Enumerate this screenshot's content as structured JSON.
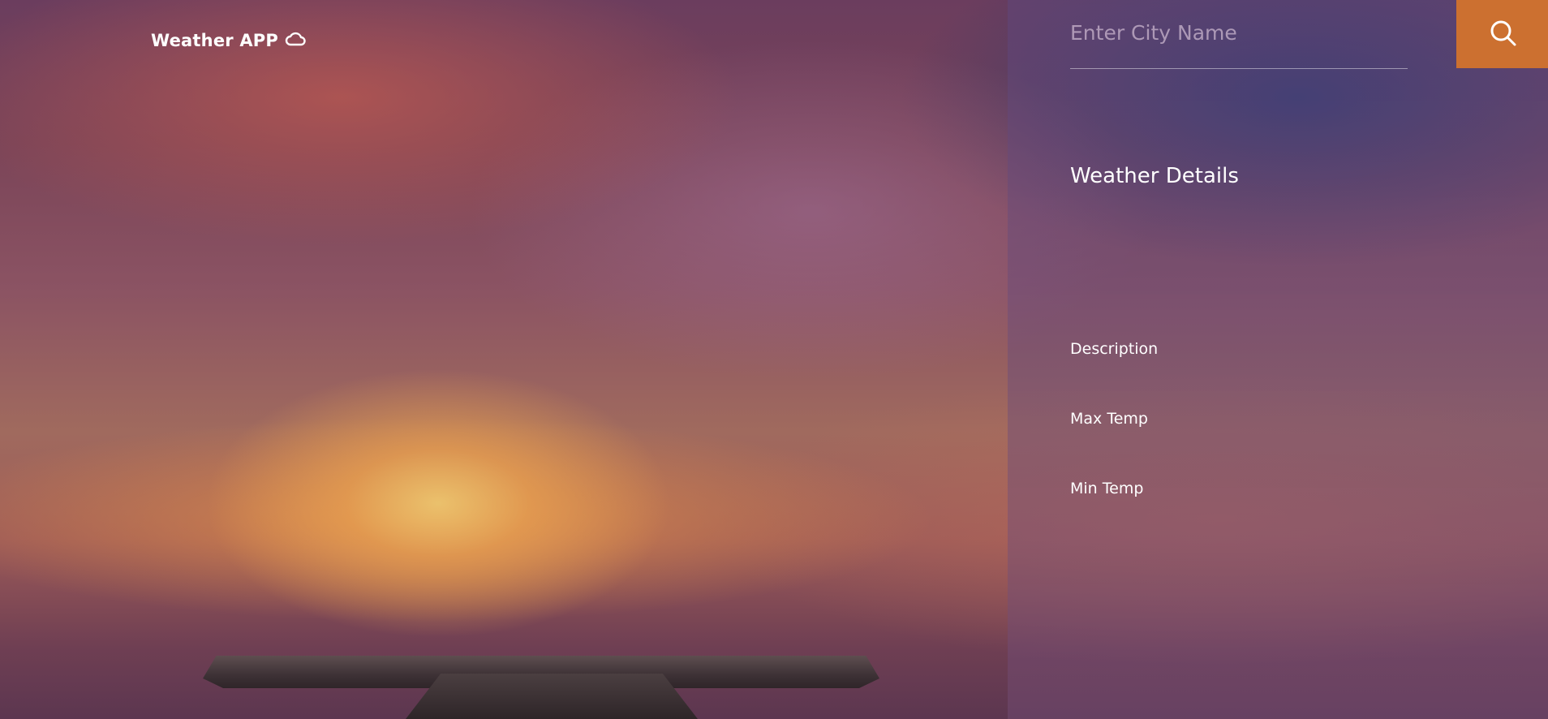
{
  "header": {
    "app_title": "Weather APP",
    "logo_icon": "cloud-icon"
  },
  "search": {
    "placeholder": "Enter City Name",
    "value": "",
    "button_icon": "search-icon",
    "button_color": "#cc7030"
  },
  "details": {
    "title": "Weather Details",
    "rows": [
      {
        "label": "Description"
      },
      {
        "label": "Max Temp"
      },
      {
        "label": "Min Temp"
      }
    ]
  }
}
